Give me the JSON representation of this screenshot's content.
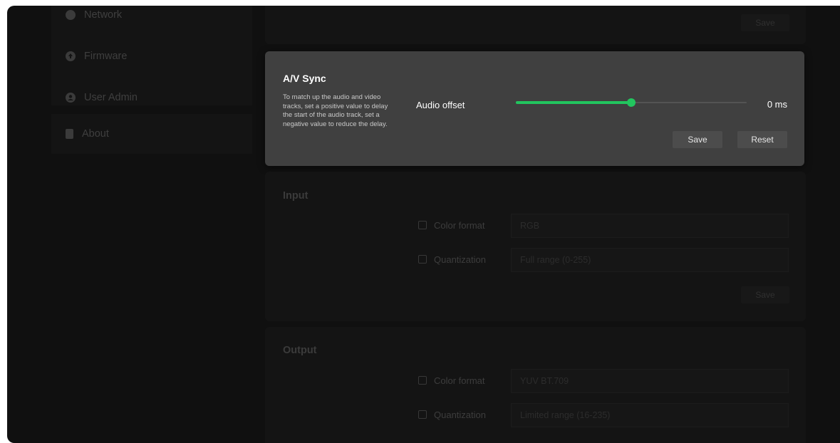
{
  "sidebar": {
    "items": [
      {
        "label": "Network",
        "icon": "globe-icon"
      },
      {
        "label": "Firmware",
        "icon": "upload-icon"
      },
      {
        "label": "User Admin",
        "icon": "user-icon"
      },
      {
        "label": "About",
        "icon": "document-icon"
      }
    ]
  },
  "top_card": {
    "save_label": "Save"
  },
  "av_sync": {
    "title": "A/V Sync",
    "description": "To match up the audio and video tracks, set a positive value to delay the start of the audio track, set a negative value to reduce the delay.",
    "offset_label": "Audio offset",
    "offset_value": "0 ms",
    "slider_fraction": 0.5,
    "save_label": "Save",
    "reset_label": "Reset",
    "accent": "#22c55e"
  },
  "input": {
    "title": "Input",
    "color_format_label": "Color format",
    "color_format_value": "RGB",
    "quantization_label": "Quantization",
    "quantization_value": "Full range (0-255)",
    "save_label": "Save"
  },
  "output": {
    "title": "Output",
    "color_format_label": "Color format",
    "color_format_value": "YUV BT.709",
    "quantization_label": "Quantization",
    "quantization_value": "Limited range (16-235)"
  }
}
